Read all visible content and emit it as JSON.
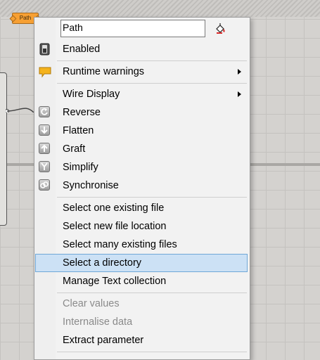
{
  "param_chip": {
    "label": "Path"
  },
  "menu": {
    "name_value": "Path",
    "items": [
      {
        "label": "Enabled",
        "icon": "enabled-toggle-icon"
      },
      {
        "label": "Runtime warnings",
        "icon": "warning-bubble-icon",
        "submenu": true
      },
      {
        "label": "Wire Display",
        "submenu": true
      },
      {
        "label": "Reverse",
        "icon": "reverse-icon"
      },
      {
        "label": "Flatten",
        "icon": "flatten-icon"
      },
      {
        "label": "Graft",
        "icon": "graft-icon"
      },
      {
        "label": "Simplify",
        "icon": "simplify-icon"
      },
      {
        "label": "Synchronise",
        "icon": "synchronise-icon"
      },
      {
        "label": "Select one existing file"
      },
      {
        "label": "Select new file location"
      },
      {
        "label": "Select many existing files"
      },
      {
        "label": "Select a directory",
        "selected": true
      },
      {
        "label": "Manage Text collection"
      },
      {
        "label": "Clear values",
        "disabled": true
      },
      {
        "label": "Internalise data",
        "disabled": true
      },
      {
        "label": "Extract parameter"
      }
    ]
  },
  "colors": {
    "highlight": "#cce1f5",
    "highlight_border": "#6fa7d7",
    "chip": "#f7a033"
  }
}
